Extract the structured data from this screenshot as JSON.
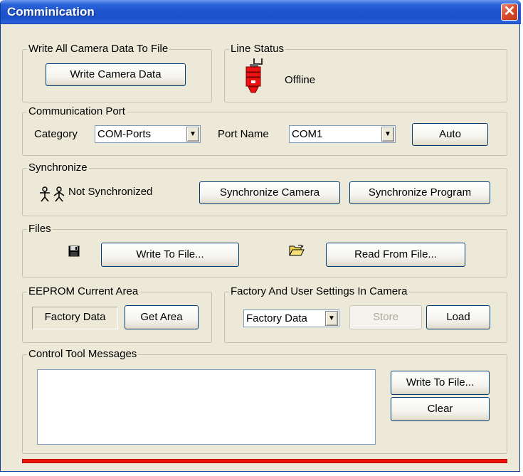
{
  "window": {
    "title": "Comminication",
    "close_glyph": "✕"
  },
  "write_all": {
    "legend": "Write All Camera Data To File",
    "button": "Write Camera Data"
  },
  "line_status": {
    "legend": "Line Status",
    "status": "Offline",
    "icon": "plug-connector-icon"
  },
  "comm_port": {
    "legend": "Communication Port",
    "category_label": "Category",
    "category_value": "COM-Ports",
    "port_label": "Port Name",
    "port_value": "COM1",
    "auto_button": "Auto"
  },
  "synchronize": {
    "legend": "Synchronize",
    "status": "Not Synchronized",
    "camera_button": "Synchronize Camera",
    "program_button": "Synchronize Program"
  },
  "files": {
    "legend": "Files",
    "write_button": "Write To File...",
    "read_button": "Read From File..."
  },
  "eeprom": {
    "legend": "EEPROM Current Area",
    "area_value": "Factory Data",
    "get_button": "Get Area"
  },
  "factory_user": {
    "legend": "Factory And User Settings In Camera",
    "select_value": "Factory Data",
    "store_button": "Store",
    "load_button": "Load"
  },
  "messages": {
    "legend": "Control Tool Messages",
    "write_button": "Write To File...",
    "clear_button": "Clear"
  },
  "progress": {
    "value_percent": 100
  },
  "colors": {
    "progress": "#f0140f",
    "titlebar": "#1f54cf",
    "dialog_bg": "#ece9d8"
  }
}
